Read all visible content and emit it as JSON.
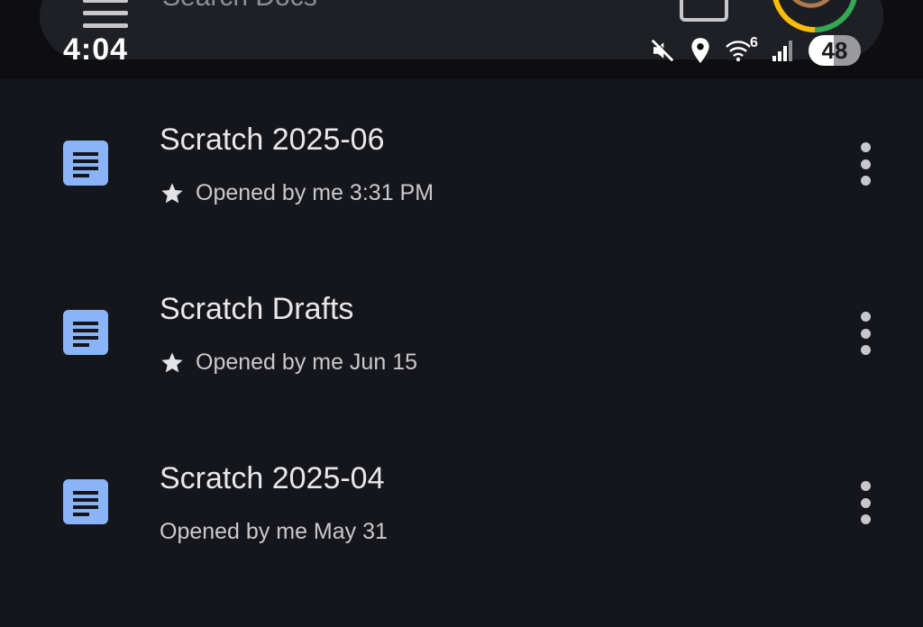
{
  "search": {
    "placeholder": "Search Docs"
  },
  "status_bar": {
    "time": "4:04",
    "wifi_label": "6",
    "battery": "48",
    "icons": [
      "mute-icon",
      "location-icon",
      "wifi-icon",
      "signal-icon",
      "battery-icon"
    ]
  },
  "documents": [
    {
      "title": "Scratch 2025-06",
      "starred": true,
      "meta": "Opened by me 3:31 PM"
    },
    {
      "title": "Scratch Drafts",
      "starred": true,
      "meta": "Opened by me Jun 15"
    },
    {
      "title": "Scratch 2025-04",
      "starred": false,
      "meta": "Opened by me May 31"
    }
  ],
  "colors": {
    "background": "#15161b",
    "doc_icon": "#8ab4f8",
    "text_primary": "#e8e8ea",
    "text_secondary": "#c9c9cd"
  }
}
